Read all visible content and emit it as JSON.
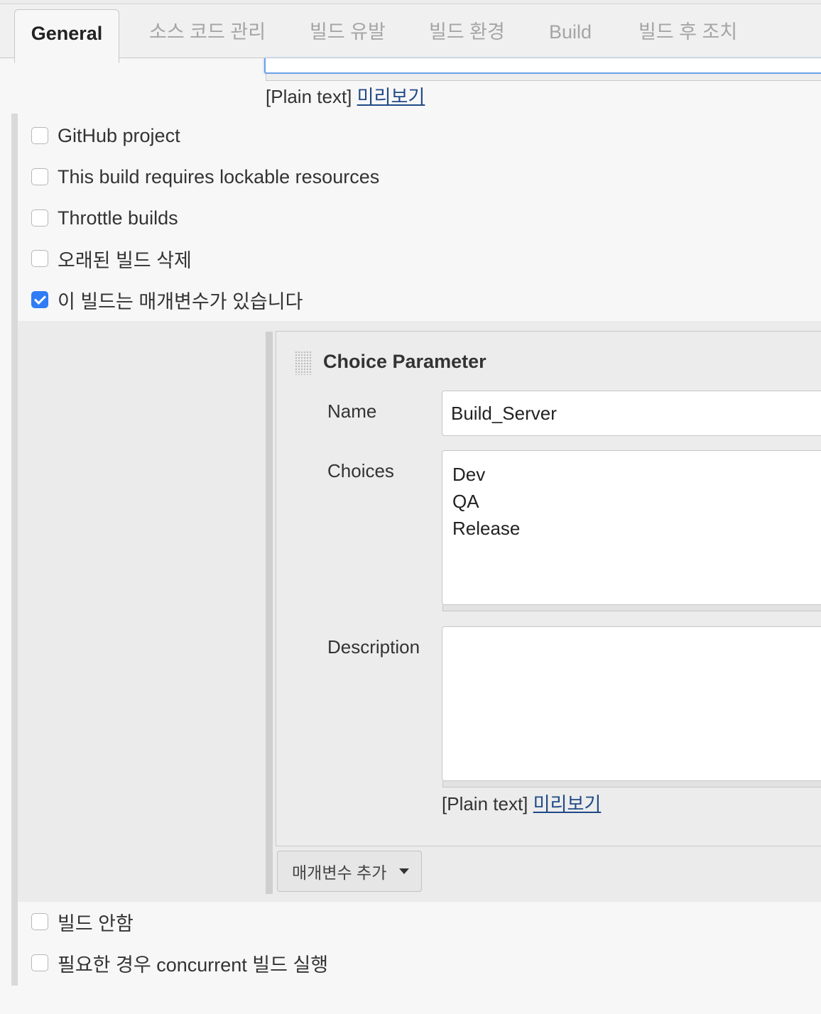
{
  "tabs": [
    {
      "label": "General",
      "active": true
    },
    {
      "label": "소스 코드 관리"
    },
    {
      "label": "빌드 유발"
    },
    {
      "label": "빌드 환경"
    },
    {
      "label": "Build"
    },
    {
      "label": "빌드 후 조치"
    }
  ],
  "description_helper": {
    "plain": "[Plain text]",
    "preview": "미리보기"
  },
  "options": [
    {
      "label": "GitHub project",
      "checked": false
    },
    {
      "label": "This build requires lockable resources",
      "checked": false
    },
    {
      "label": "Throttle builds",
      "checked": false
    },
    {
      "label": "오래된 빌드 삭제",
      "checked": false
    },
    {
      "label": "이 빌드는 매개변수가 있습니다",
      "checked": true
    }
  ],
  "parameter": {
    "title": "Choice Parameter",
    "name_label": "Name",
    "name_value": "Build_Server",
    "choices_label": "Choices",
    "choices": [
      "Dev",
      "QA",
      "Release"
    ],
    "description_label": "Description",
    "description_value": "",
    "plain": "[Plain text]",
    "preview": "미리보기"
  },
  "add_parameter_label": "매개변수 추가",
  "bottom_options": [
    {
      "label": "빌드 안함",
      "checked": false
    },
    {
      "label": "필요한 경우 concurrent 빌드 실행",
      "checked": false
    }
  ],
  "colors": {
    "accent": "#2f7cf6",
    "link": "#204a87"
  }
}
